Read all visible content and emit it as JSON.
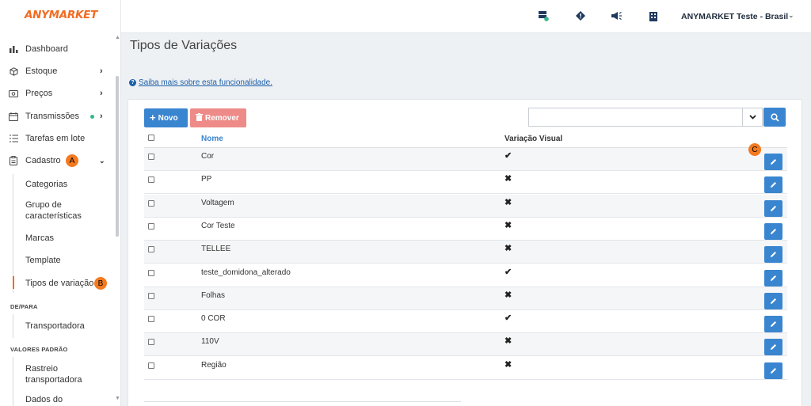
{
  "brand": {
    "logo": "ANYMARKET",
    "accent": "#f26b21",
    "primary": "#3a85d0",
    "danger": "#ee8b88"
  },
  "topbar": {
    "icons": [
      "server-status-icon",
      "alert-diamond-icon",
      "megaphone-icon",
      "building-icon"
    ],
    "user_name": "ANYMARKET Teste - Brasil"
  },
  "sidebar": {
    "items": [
      {
        "label": "Dashboard",
        "icon": "bar-chart-icon"
      },
      {
        "label": "Estoque",
        "icon": "box-icon"
      },
      {
        "label": "Preços",
        "icon": "money-icon"
      },
      {
        "label": "Transmissões",
        "icon": "transmission-icon"
      },
      {
        "label": "Tarefas em lote",
        "icon": "list-icon"
      },
      {
        "label": "Cadastro",
        "icon": "clipboard-icon"
      }
    ],
    "cadastro_sub": [
      "Categorias",
      "Grupo de características",
      "Marcas",
      "Template",
      "Tipos de variação"
    ],
    "section_depara": "DE/PARA",
    "depara_sub": [
      "Transportadora"
    ],
    "section_valores": "VALORES PADRÃO",
    "valores_sub": [
      "Rastreio transportadora",
      "Dados do"
    ],
    "badges": {
      "a": "A",
      "b": "B",
      "c": "C"
    }
  },
  "page": {
    "title": "Tipos de Variações",
    "help_link": "Saiba mais sobre esta funcionalidade.",
    "new_button": "Novo",
    "remove_button": "Remover",
    "search_value": ""
  },
  "table": {
    "columns": {
      "name": "Nome",
      "visual": "Variação Visual"
    },
    "rows": [
      {
        "name": "Cor",
        "visual": true
      },
      {
        "name": "PP",
        "visual": false
      },
      {
        "name": "Voltagem",
        "visual": false
      },
      {
        "name": "Cor Teste",
        "visual": false
      },
      {
        "name": "TELLEE",
        "visual": false
      },
      {
        "name": "teste_domidona_alterado",
        "visual": true
      },
      {
        "name": "Folhas",
        "visual": false
      },
      {
        "name": "0 COR",
        "visual": true
      },
      {
        "name": "110V",
        "visual": false
      },
      {
        "name": "Região",
        "visual": false
      }
    ]
  }
}
